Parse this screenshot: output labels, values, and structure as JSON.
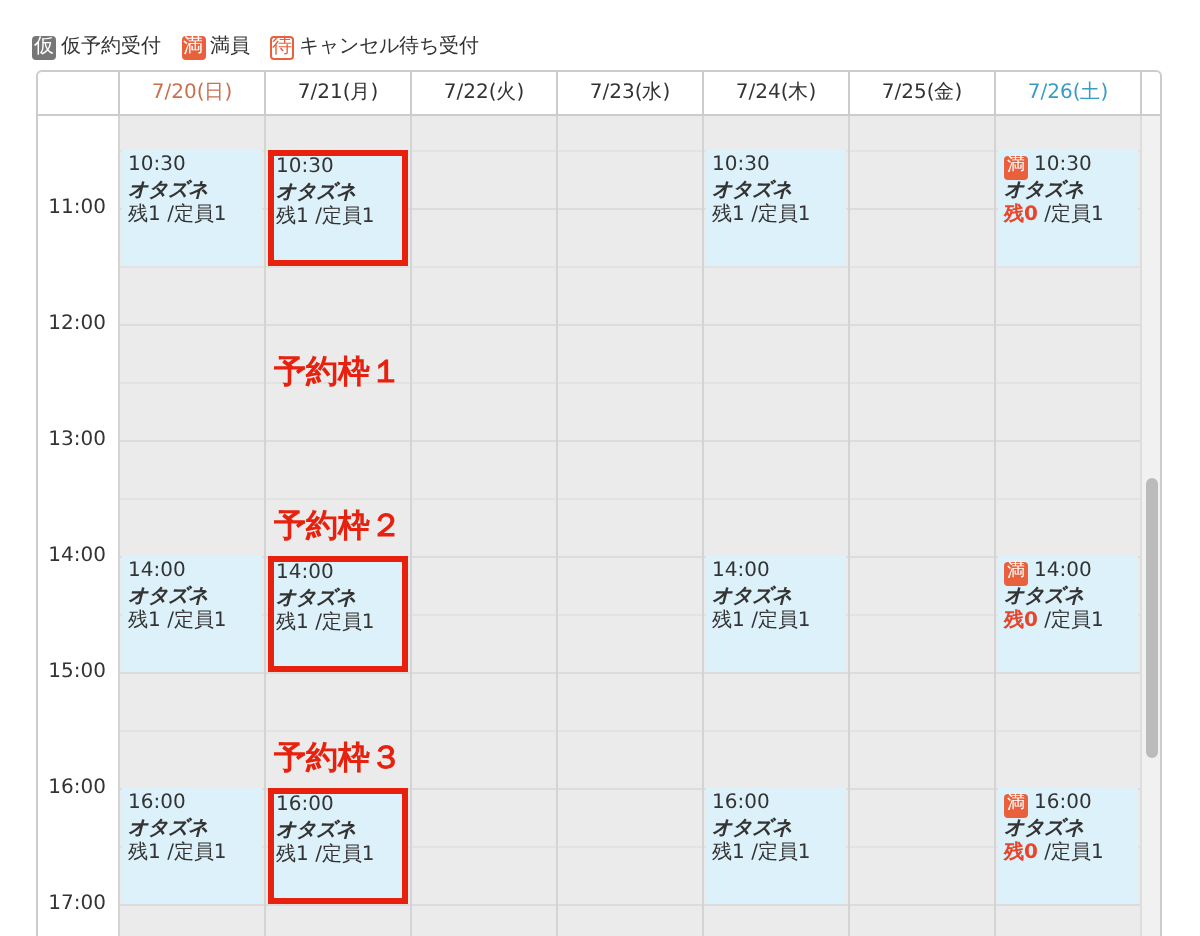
{
  "legend": [
    {
      "kind": "tentative",
      "mark": "仮",
      "label": "仮予約受付"
    },
    {
      "kind": "full",
      "mark": "満",
      "label": "満員"
    },
    {
      "kind": "waitlist",
      "mark": "待",
      "label": "キャンセル待ち受付"
    }
  ],
  "days": [
    {
      "label": "7/20(日)",
      "color": "#c8714f"
    },
    {
      "label": "7/21(月)",
      "color": "#333333"
    },
    {
      "label": "7/22(火)",
      "color": "#333333"
    },
    {
      "label": "7/23(水)",
      "color": "#333333"
    },
    {
      "label": "7/24(木)",
      "color": "#333333"
    },
    {
      "label": "7/25(金)",
      "color": "#333333"
    },
    {
      "label": "7/26(土)",
      "color": "#3a9cc4"
    }
  ],
  "hours": [
    "11:00",
    "12:00",
    "13:00",
    "14:00",
    "15:00",
    "16:00",
    "17:00"
  ],
  "slots": [
    {
      "annotation": "予約枠１",
      "cells": [
        {
          "kind": "open",
          "time": "10:30",
          "name": "オタズネ",
          "remaining": "残1",
          "capacity": "/定員1",
          "highlighted": false
        },
        {
          "kind": "open",
          "time": "10:30",
          "name": "オタズネ",
          "remaining": "残1",
          "capacity": "/定員1",
          "highlighted": true
        },
        {
          "kind": "empty"
        },
        {
          "kind": "empty"
        },
        {
          "kind": "open",
          "time": "10:30",
          "name": "オタズネ",
          "remaining": "残1",
          "capacity": "/定員1",
          "highlighted": false
        },
        {
          "kind": "empty"
        },
        {
          "kind": "full",
          "badge": "満",
          "time": "10:30",
          "name": "オタズネ",
          "remaining": "残0",
          "capacity": "/定員1",
          "highlighted": false
        }
      ]
    },
    {
      "annotation": "予約枠２",
      "cells": [
        {
          "kind": "open",
          "time": "14:00",
          "name": "オタズネ",
          "remaining": "残1",
          "capacity": "/定員1",
          "highlighted": false
        },
        {
          "kind": "open",
          "time": "14:00",
          "name": "オタズネ",
          "remaining": "残1",
          "capacity": "/定員1",
          "highlighted": true
        },
        {
          "kind": "empty"
        },
        {
          "kind": "empty"
        },
        {
          "kind": "open",
          "time": "14:00",
          "name": "オタズネ",
          "remaining": "残1",
          "capacity": "/定員1",
          "highlighted": false
        },
        {
          "kind": "empty"
        },
        {
          "kind": "full",
          "badge": "満",
          "time": "14:00",
          "name": "オタズネ",
          "remaining": "残0",
          "capacity": "/定員1",
          "highlighted": false
        }
      ]
    },
    {
      "annotation": "予約枠３",
      "cells": [
        {
          "kind": "open",
          "time": "16:00",
          "name": "オタズネ",
          "remaining": "残1",
          "capacity": "/定員1",
          "highlighted": false
        },
        {
          "kind": "open",
          "time": "16:00",
          "name": "オタズネ",
          "remaining": "残1",
          "capacity": "/定員1",
          "highlighted": true
        },
        {
          "kind": "empty"
        },
        {
          "kind": "empty"
        },
        {
          "kind": "open",
          "time": "16:00",
          "name": "オタズネ",
          "remaining": "残1",
          "capacity": "/定員1",
          "highlighted": false
        },
        {
          "kind": "empty"
        },
        {
          "kind": "full",
          "badge": "満",
          "time": "16:00",
          "name": "オタズネ",
          "remaining": "残0",
          "capacity": "/定員1",
          "highlighted": false
        }
      ]
    }
  ]
}
